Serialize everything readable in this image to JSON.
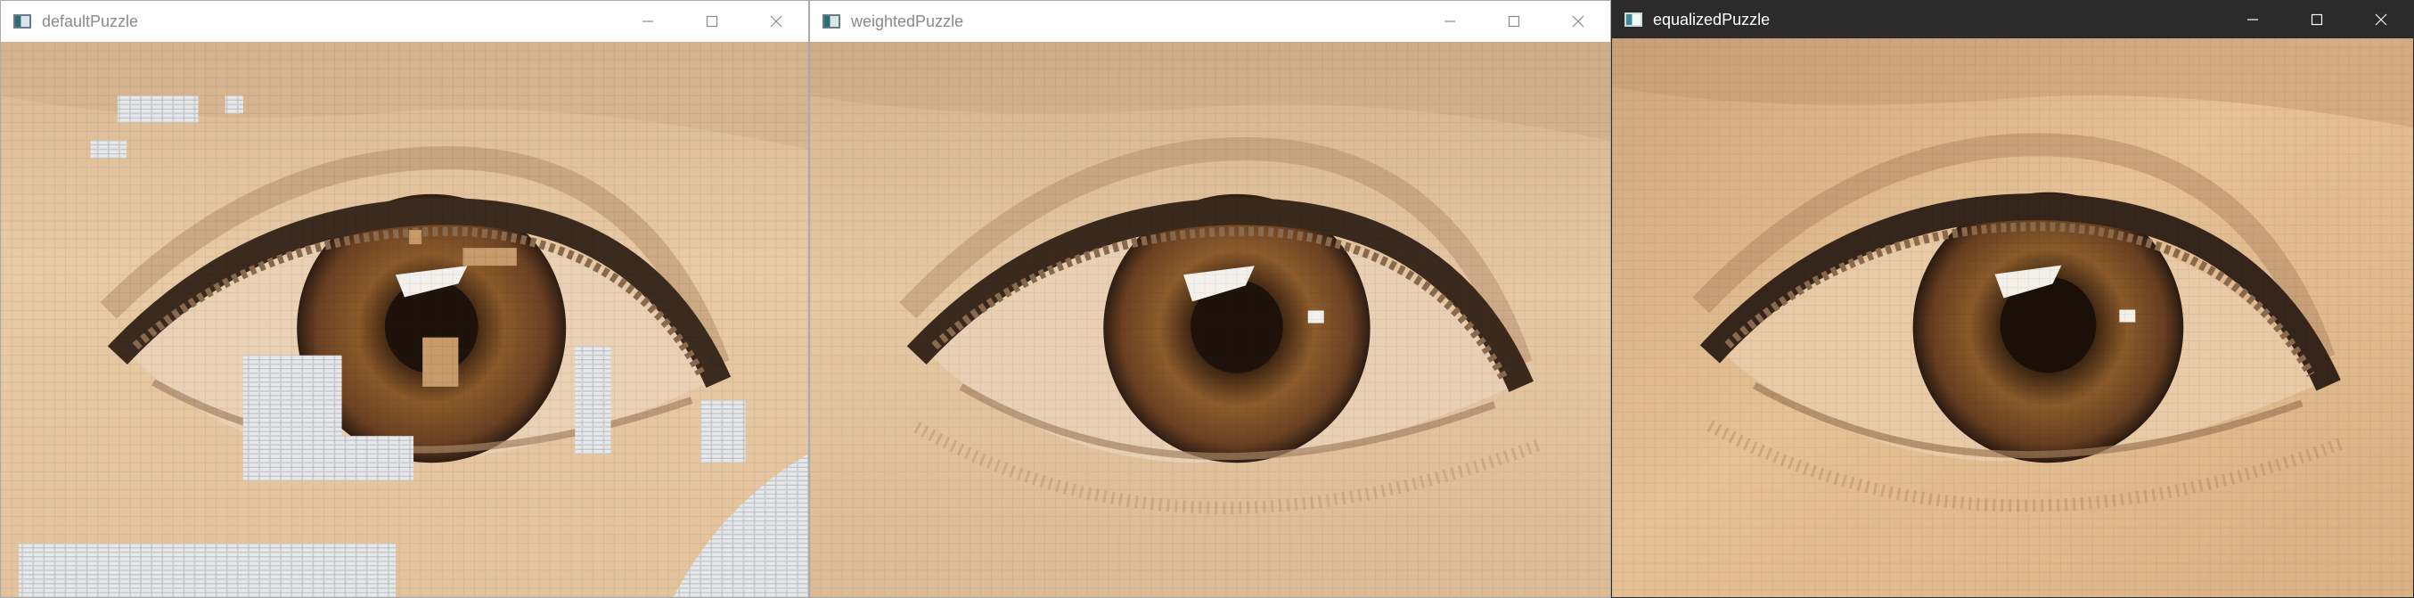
{
  "windows": [
    {
      "title": "defaultPuzzle",
      "state": "inactive",
      "icon": "app-window-icon",
      "controls": [
        "minimize-icon",
        "maximize-icon",
        "close-icon"
      ],
      "content": "eye-photo-mosaic",
      "palette": {
        "skin": "#e7c9a2",
        "skin_shadow": "#c9a684",
        "iris": "#7a4a22",
        "pupil": "#1e120a",
        "lash": "#3b2a1e",
        "tile_patch": "#cfd4da"
      }
    },
    {
      "title": "weightedPuzzle",
      "state": "inactive",
      "icon": "app-window-icon",
      "controls": [
        "minimize-icon",
        "maximize-icon",
        "close-icon"
      ],
      "content": "eye-photo-mosaic",
      "palette": {
        "skin": "#e5c7a2",
        "skin_shadow": "#c8a584",
        "iris": "#7b4b24",
        "pupil": "#1e120a",
        "lash": "#3a291d"
      }
    },
    {
      "title": "equalizedPuzzle",
      "state": "active",
      "icon": "app-window-icon",
      "controls": [
        "minimize-icon",
        "maximize-icon",
        "close-icon"
      ],
      "content": "eye-photo-mosaic",
      "palette": {
        "skin": "#e2bd92",
        "skin_shadow": "#c39a72",
        "iris": "#7a4a22",
        "pupil": "#1b0f08",
        "lash": "#35251a"
      }
    }
  ],
  "colors": {
    "titlebar_inactive": "#ffffff",
    "titlebar_active": "#2b2b2b",
    "title_text_inactive": "#8a8a8a",
    "title_text_active": "#ffffff"
  }
}
